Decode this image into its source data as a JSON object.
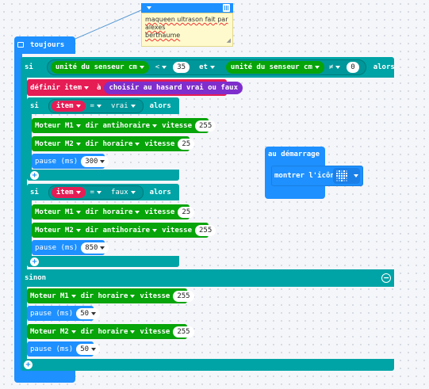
{
  "comment": {
    "text_line1": "maqueen ultrason fait par alexes",
    "text_line2": "berthaume"
  },
  "forever": {
    "label": "toujours",
    "if": {
      "label": "si",
      "cond_left": "unité du senseur cm",
      "op1": "<",
      "val1": "35",
      "and": "et",
      "cond_right": "unité du senseur cm",
      "op2": "≠",
      "val2": "0",
      "alors": "alors"
    },
    "set_item": {
      "label": "définir item",
      "to": "à",
      "value": "choisir au hasard vrai ou faux"
    },
    "if_true": {
      "label": "si",
      "var": "item",
      "op": "=",
      "value": "vrai",
      "alors": "alors",
      "motor1": {
        "label": "Moteur M1",
        "dir": "dir antihoraire",
        "speed_label": "vitesse",
        "speed": "255"
      },
      "motor2": {
        "label": "Moteur M2",
        "dir": "dir horaire",
        "speed_label": "vitesse",
        "speed": "25"
      },
      "pause": {
        "label": "pause (ms)",
        "value": "300"
      }
    },
    "if_false": {
      "label": "si",
      "var": "item",
      "op": "=",
      "value": "faux",
      "alors": "alors",
      "motor1": {
        "label": "Moteur M1",
        "dir": "dir horaire",
        "speed_label": "vitesse",
        "speed": "25"
      },
      "motor2": {
        "label": "Moteur M2",
        "dir": "dir antihoraire",
        "speed_label": "vitesse",
        "speed": "255"
      },
      "pause": {
        "label": "pause (ms)",
        "value": "850"
      }
    },
    "else": {
      "label": "sinon",
      "motor1": {
        "label": "Moteur M1",
        "dir": "dir horaire",
        "speed_label": "vitesse",
        "speed": "255"
      },
      "pause1": {
        "label": "pause (ms)",
        "value": "50"
      },
      "motor2": {
        "label": "Moteur M2",
        "dir": "dir horaire",
        "speed_label": "vitesse",
        "speed": "255"
      },
      "pause2": {
        "label": "pause (ms)",
        "value": "50"
      }
    }
  },
  "on_start": {
    "label": "au démarrage",
    "show_icon": "montrer l'icône",
    "icon": "heart-icon"
  },
  "colors": {
    "basic": "#1e90ff",
    "logic": "#00a4a6",
    "motor": "#07a40a",
    "variable": "#e61c55",
    "random": "#7e2ecc"
  }
}
